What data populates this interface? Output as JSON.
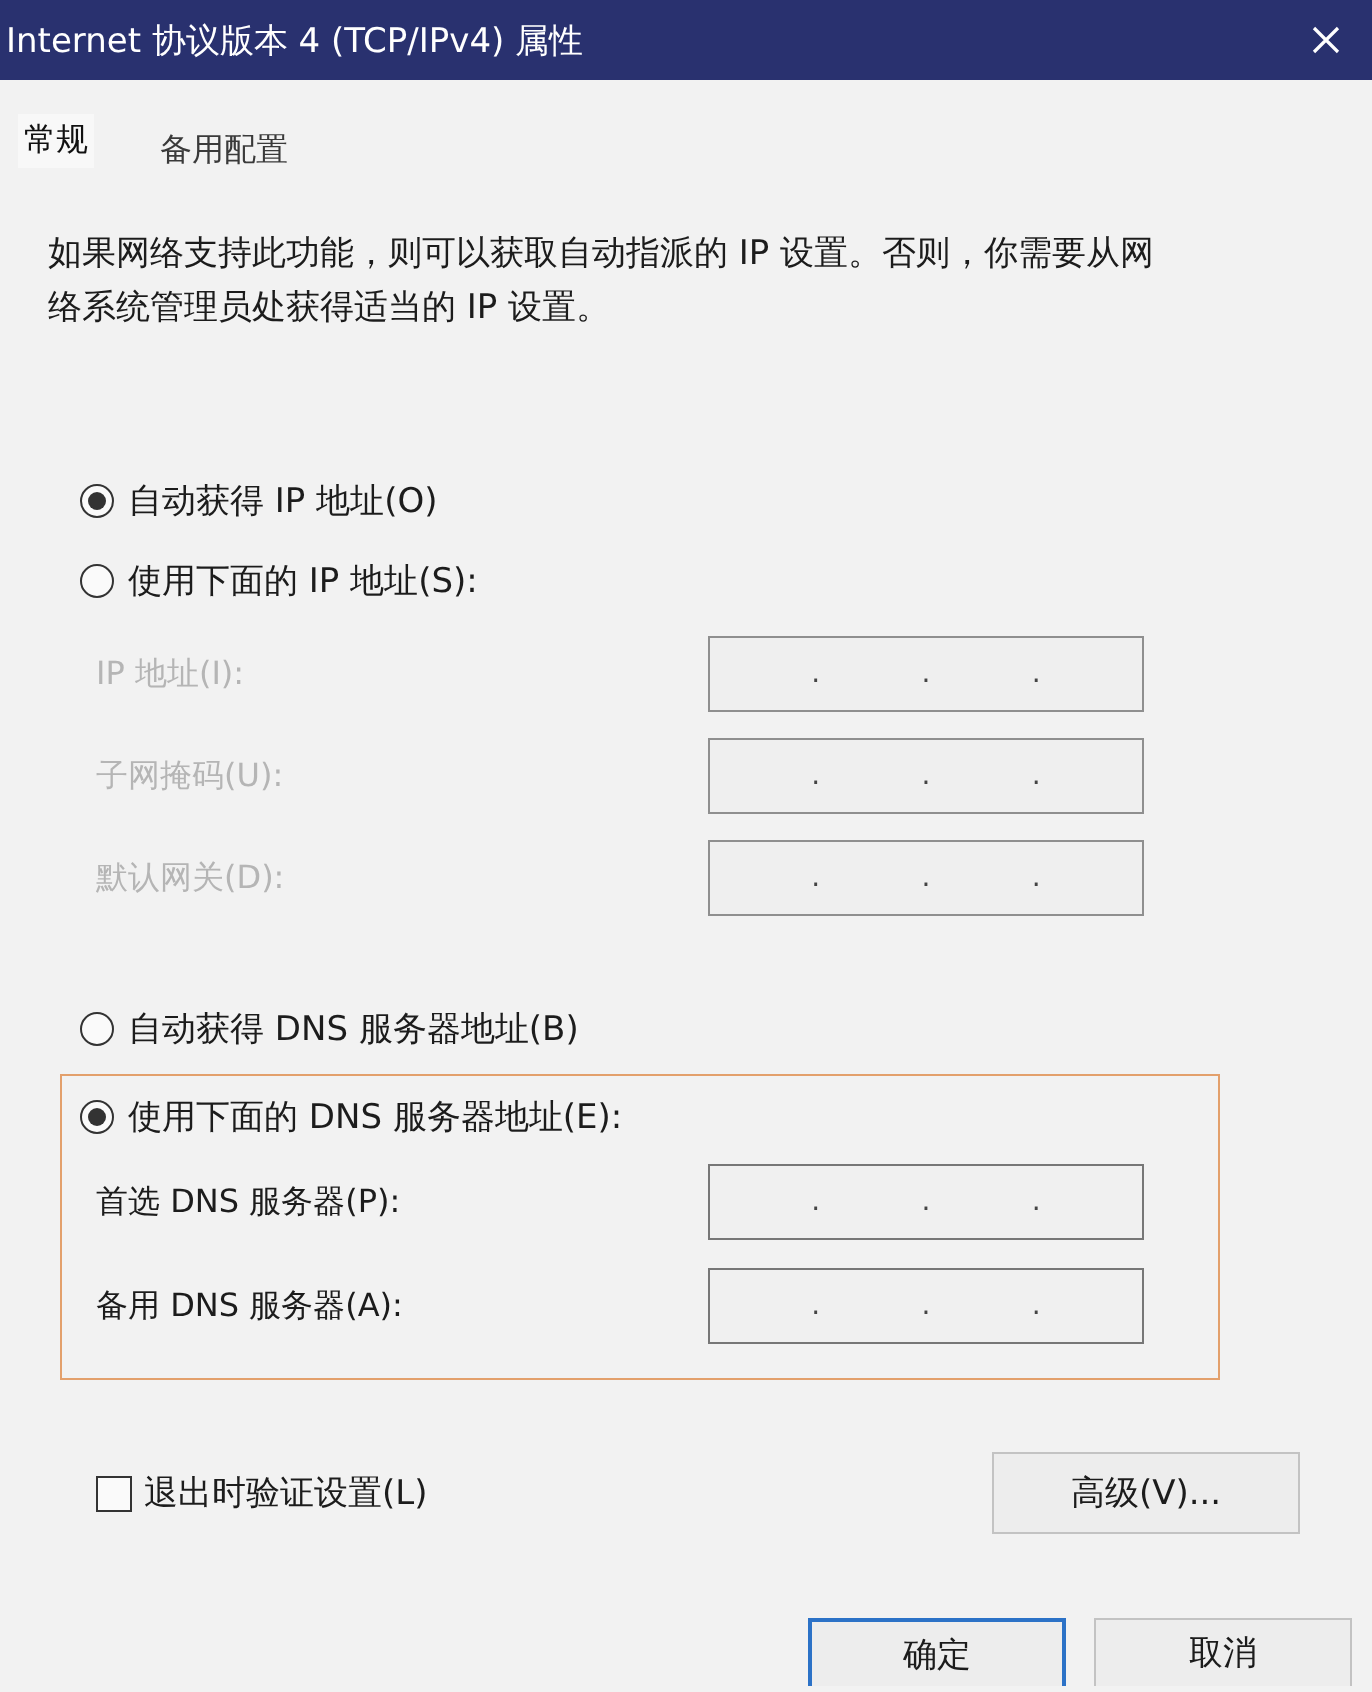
{
  "window": {
    "title": "Internet 协议版本 4 (TCP/IPv4) 属性"
  },
  "tabs": [
    {
      "label": "常规",
      "selected": true
    },
    {
      "label": "备用配置",
      "selected": false
    }
  ],
  "description": "如果网络支持此功能，则可以获取自动指派的 IP 设置。否则，你需要从网络系统管理员处获得适当的 IP 设置。",
  "ip_section": {
    "options": [
      {
        "label": "自动获得 IP 地址(O)",
        "selected": true
      },
      {
        "label": "使用下面的 IP 地址(S):",
        "selected": false
      }
    ],
    "fields": [
      {
        "label": "IP 地址(I):",
        "disabled": true,
        "separators": [
          ".",
          ".",
          "."
        ]
      },
      {
        "label": "子网掩码(U):",
        "disabled": true,
        "separators": [
          ".",
          ".",
          "."
        ]
      },
      {
        "label": "默认网关(D):",
        "disabled": true,
        "separators": [
          ".",
          ".",
          "."
        ]
      }
    ]
  },
  "dns_section": {
    "highlighted": true,
    "options": [
      {
        "label": "自动获得 DNS 服务器地址(B)",
        "selected": false
      },
      {
        "label": "使用下面的 DNS 服务器地址(E):",
        "selected": true
      }
    ],
    "fields": [
      {
        "label": "首选 DNS 服务器(P):",
        "disabled": false,
        "separators": [
          ".",
          ".",
          "."
        ]
      },
      {
        "label": "备用 DNS 服务器(A):",
        "disabled": false,
        "separators": [
          ".",
          ".",
          "."
        ]
      }
    ]
  },
  "validate_checkbox": {
    "label": "退出时验证设置(L)",
    "checked": false
  },
  "advanced_button": {
    "label": "高级(V)..."
  },
  "buttons": [
    {
      "label": "确定",
      "default": true
    },
    {
      "label": "取消",
      "default": false
    }
  ]
}
